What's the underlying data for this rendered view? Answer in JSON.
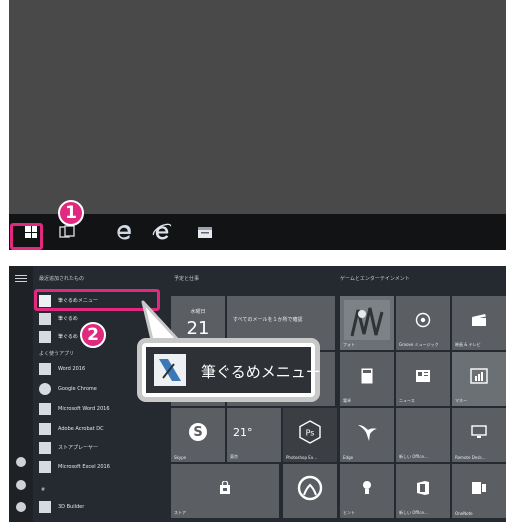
{
  "panel1": {
    "taskbar": {
      "items": [
        {
          "name": "start-button",
          "icon": "windows-icon"
        },
        {
          "name": "task-view-button",
          "icon": "task-view-icon"
        },
        {
          "name": "edge-button",
          "icon": "edge-icon"
        },
        {
          "name": "ie-button",
          "icon": "internet-explorer-icon"
        },
        {
          "name": "file-explorer-button",
          "icon": "folder-icon"
        }
      ]
    },
    "badge": "1"
  },
  "panel2": {
    "badge": "2",
    "recent_header": "最近追加されたもの",
    "frequent_header": "よく使うアプリ",
    "apps": [
      {
        "label": "筆ぐるめメニュー"
      },
      {
        "label": "筆ぐるめ"
      },
      {
        "label": "筆ぐるめ"
      },
      {
        "label": "Word 2016"
      },
      {
        "label": "Google Chrome"
      },
      {
        "label": "Microsoft Word 2016"
      },
      {
        "label": "Adobe Acrobat DC"
      },
      {
        "label": "ストアプレーヤー"
      },
      {
        "label": "Microsoft Excel 2016"
      }
    ],
    "bottom_app": "3D Builder",
    "section_letter": "#",
    "group1_header": "予定と仕事",
    "group2_header": "ゲームとエンターテインメント",
    "tiles": {
      "calendar_day": "水曜日",
      "calendar_date": "21",
      "mail_text": "すべてのメールを１か所で確認",
      "weather_temp": "21°",
      "weather_caption": "東京",
      "skype": "Skype",
      "photoshop": "Photoshop Ex...",
      "store": "ストア",
      "movies": "映画 & テレビ",
      "groove": "Groove ミュージック",
      "photos": "フォト",
      "calculator": "電卓",
      "news": "ニュース",
      "money": "マネー",
      "edge_label": "Edge",
      "remote_desktop": "Remote Desk...",
      "office": "新しい Office...",
      "onenote": "OneNote",
      "hint": "ヒント",
      "sway": "Sway",
      "xbox": "Xbox"
    },
    "callout": {
      "label": "筆ぐるめメニュー"
    }
  },
  "colors": {
    "accent": "#e0297f",
    "panel1_bg": "#494949",
    "taskbar_bg": "#111315",
    "startmenu_bg": "#252a30",
    "tile_bg": "#5b5f64"
  }
}
